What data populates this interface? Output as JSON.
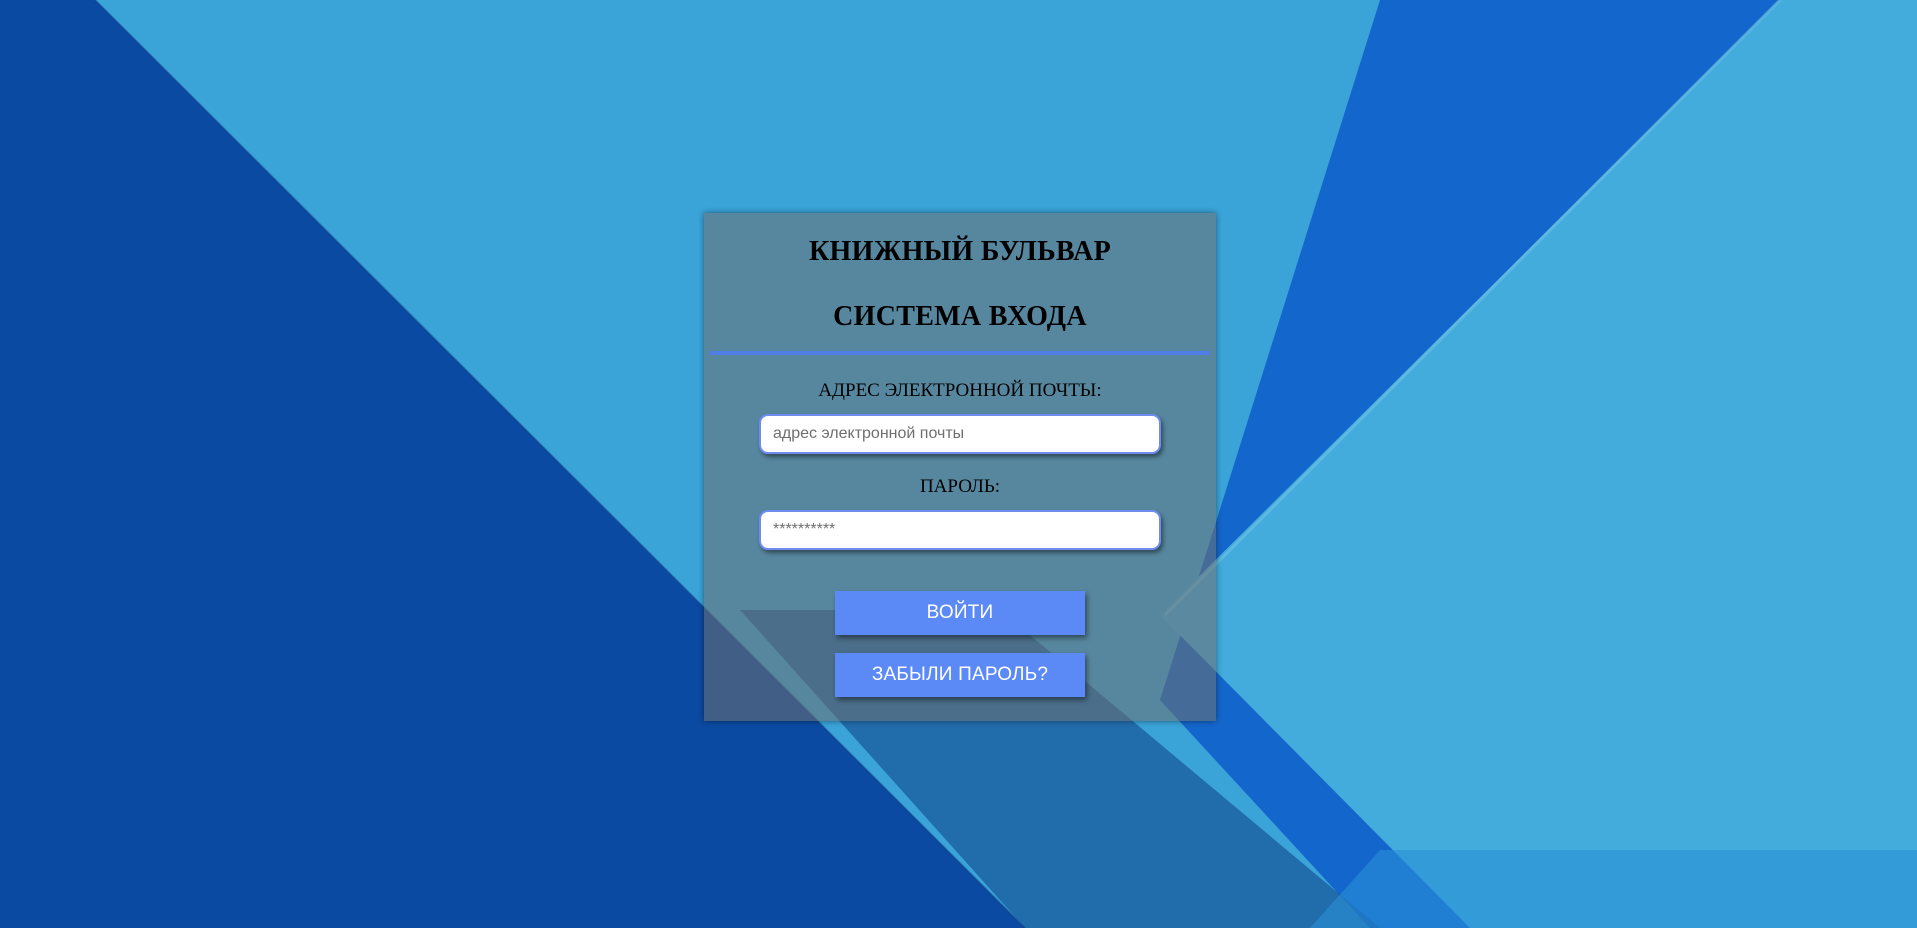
{
  "background": {
    "colors": {
      "deep_blue": "#0a4aa6",
      "mid_blue": "#1366cc",
      "light_blue": "#3ba3d8",
      "pale_blue": "#4bb0dd"
    }
  },
  "login": {
    "site_title": "КНИЖНЫЙ БУЛЬВАР",
    "form_title": "СИСТЕМА ВХОДА",
    "email_label": "АДРЕС ЭЛЕКТРОННОЙ ПОЧТЫ:",
    "email_placeholder": "адрес электронной почты",
    "password_label": "ПАРОЛЬ:",
    "password_placeholder": "**********",
    "login_button": "ВОЙТИ",
    "forgot_button": "ЗАБЫЛИ ПАРОЛЬ?",
    "accent_color": "#5b8af7"
  }
}
